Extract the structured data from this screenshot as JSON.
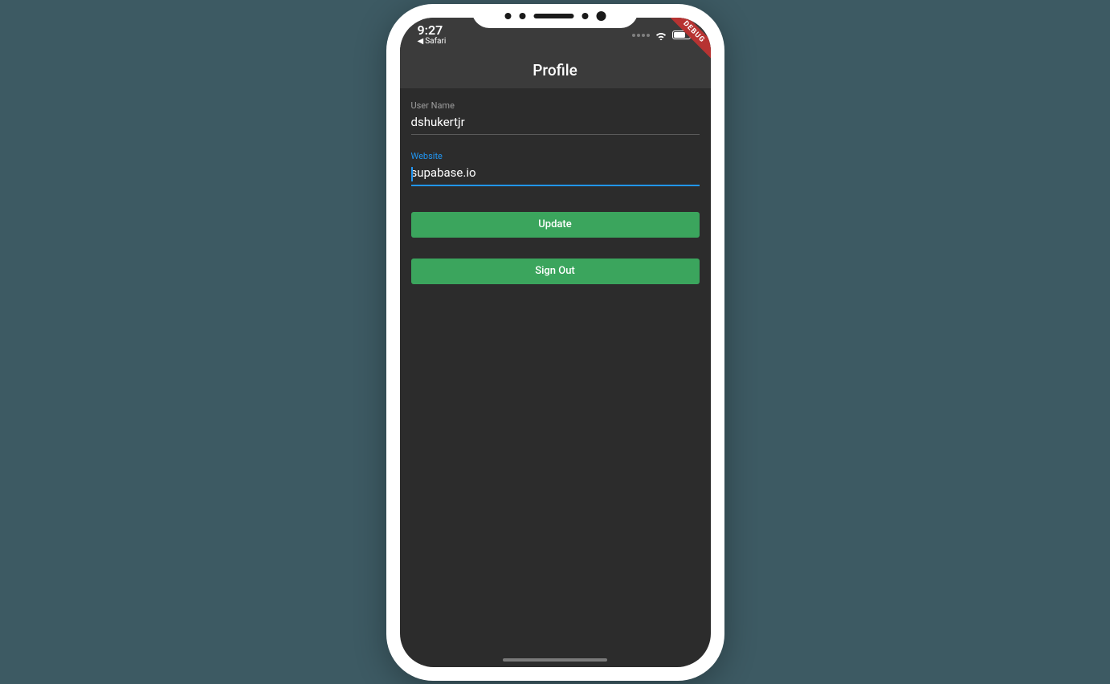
{
  "status_bar": {
    "time": "9:27",
    "back_app": "Safari",
    "debug_label": "DEBUG"
  },
  "app_bar": {
    "title": "Profile"
  },
  "form": {
    "username_label": "User Name",
    "username_value": "dshukertjr",
    "website_label": "Website",
    "website_value": "supabase.io"
  },
  "buttons": {
    "update": "Update",
    "sign_out": "Sign Out"
  },
  "colors": {
    "accent": "#2196f3",
    "button": "#3ba55d",
    "background": "#2c2c2c",
    "app_bar": "#3b3b3b",
    "page_bg": "#3d5a63",
    "debug": "#b73332"
  }
}
